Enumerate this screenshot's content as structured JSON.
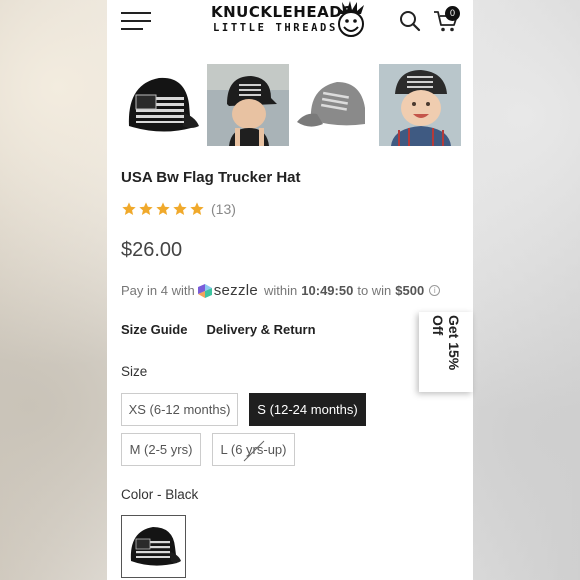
{
  "header": {
    "logo_line1": "KNUCKLEHEADS",
    "logo_line2": "LITTLE THREADS",
    "cart_count": "0",
    "icons": [
      "menu-icon",
      "search-icon",
      "cart-icon"
    ]
  },
  "thumbnails": [
    {
      "name": "black-flag-hat-front"
    },
    {
      "name": "toddler-wearing-hat-side"
    },
    {
      "name": "gray-hat-side"
    },
    {
      "name": "toddler-wearing-hat-smiling"
    }
  ],
  "product": {
    "title": "USA Bw Flag Trucker Hat",
    "rating_stars": 5,
    "rating_count": "(13)",
    "price": "$26.00"
  },
  "sezzle": {
    "prefix": "Pay in 4 with",
    "brand": "sezzle",
    "within": "within",
    "timer": "10:49:50",
    "to_win": "to win",
    "amount": "$500",
    "info": "i"
  },
  "links": {
    "size_guide": "Size Guide",
    "delivery_return": "Delivery & Return"
  },
  "size": {
    "label": "Size",
    "options": [
      {
        "label": "XS (6-12 months)",
        "selected": false,
        "available": true
      },
      {
        "label": "S (12-24 months)",
        "selected": true,
        "available": true
      },
      {
        "label": "M (2-5 yrs)",
        "selected": false,
        "available": true
      },
      {
        "label": "L (6 yrs-up)",
        "selected": false,
        "available": false
      }
    ]
  },
  "color": {
    "label": "Color - Black"
  },
  "promo": {
    "text": "Get 15% Off"
  },
  "colors": {
    "star": "#f0a92b",
    "selected_bg": "#1f1f1f",
    "text_dark": "#222222"
  }
}
